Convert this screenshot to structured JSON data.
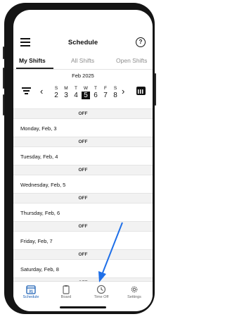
{
  "header": {
    "title": "Schedule",
    "help_glyph": "?"
  },
  "tabs": [
    {
      "label": "My Shifts"
    },
    {
      "label": "All Shifts"
    },
    {
      "label": "Open Shifts"
    }
  ],
  "calendar": {
    "month": "Feb 2025",
    "days": [
      {
        "letter": "S",
        "num": "2"
      },
      {
        "letter": "M",
        "num": "3"
      },
      {
        "letter": "T",
        "num": "4"
      },
      {
        "letter": "W",
        "num": "5"
      },
      {
        "letter": "T",
        "num": "6"
      },
      {
        "letter": "F",
        "num": "7"
      },
      {
        "letter": "S",
        "num": "8"
      }
    ],
    "selected_day": "5",
    "prev_glyph": "‹",
    "next_glyph": "›"
  },
  "schedule": {
    "off_label": "OFF",
    "days": [
      {
        "label": "Monday, Feb, 3"
      },
      {
        "label": "Tuesday, Feb, 4"
      },
      {
        "label": "Wednesday, Feb, 5"
      },
      {
        "label": "Thursday, Feb, 6"
      },
      {
        "label": "Friday, Feb, 7"
      },
      {
        "label": "Saturday, Feb, 8"
      }
    ]
  },
  "bottom_nav": {
    "items": [
      {
        "label": "Schedule",
        "icon": "calendar-icon",
        "day": "31"
      },
      {
        "label": "Board",
        "icon": "clipboard-icon"
      },
      {
        "label": "Time Off",
        "icon": "clock-icon"
      },
      {
        "label": "Settings",
        "icon": "gear-icon"
      }
    ]
  },
  "colors": {
    "accent": "#1a5fb4",
    "annotation_arrow": "#1e6fe8"
  }
}
